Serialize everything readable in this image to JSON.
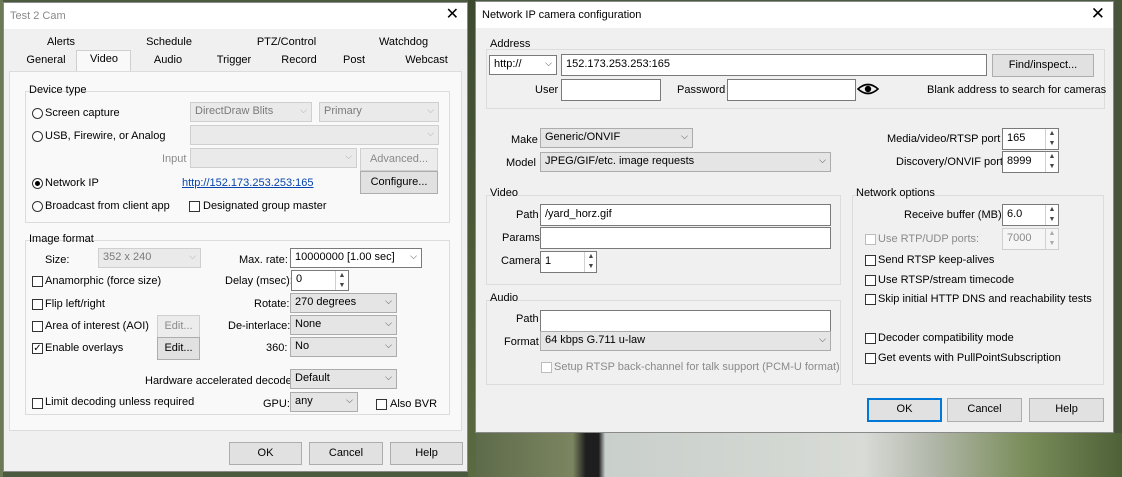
{
  "left": {
    "title": "Test 2 Cam",
    "tabs_row1": [
      "Alerts",
      "Schedule",
      "PTZ/Control",
      "Watchdog"
    ],
    "tabs_row2": [
      "General",
      "Video",
      "Audio",
      "Trigger",
      "Record",
      "Post",
      "Webcast"
    ],
    "device_type": {
      "title": "Device type",
      "screen_capture": "Screen capture",
      "directdraw": "DirectDraw Blits",
      "primary": "Primary",
      "usb": "USB, Firewire, or Analog",
      "input": "Input",
      "advanced": "Advanced...",
      "network_ip": "Network IP",
      "network_link": "http://152.173.253.253:165",
      "configure": "Configure...",
      "broadcast": "Broadcast from client app",
      "designated": "Designated group master"
    },
    "image_format": {
      "title": "Image format",
      "size_label": "Size:",
      "size_value": "352 x 240",
      "max_rate_label": "Max. rate:",
      "max_rate_value": "10000000 [1.00 sec]",
      "anamorphic": "Anamorphic (force size)",
      "delay_label": "Delay (msec):",
      "delay_value": "0",
      "flip": "Flip left/right",
      "rotate_label": "Rotate:",
      "rotate_value": "270 degrees",
      "aoi": "Area of interest (AOI)",
      "edit1": "Edit...",
      "deinterlace_label": "De-interlace:",
      "deinterlace_value": "None",
      "overlays": "Enable overlays",
      "edit2": "Edit...",
      "r360_label": "360:",
      "r360_value": "No",
      "hw_label": "Hardware accelerated decode:",
      "hw_value": "Default",
      "limit": "Limit decoding unless required",
      "gpu_label": "GPU:",
      "gpu_value": "any",
      "also_bvr": "Also BVR"
    },
    "buttons": {
      "ok": "OK",
      "cancel": "Cancel",
      "help": "Help"
    }
  },
  "right": {
    "title": "Network IP camera configuration",
    "address": {
      "title": "Address",
      "scheme": "http://",
      "host": "152.173.253.253:165",
      "find": "Find/inspect...",
      "user_label": "User",
      "user_value": "",
      "password_label": "Password",
      "password_value": "",
      "hint": "Blank address to search for cameras"
    },
    "make_label": "Make",
    "make_value": "Generic/ONVIF",
    "model_label": "Model",
    "model_value": "JPEG/GIF/etc. image requests",
    "media_port_label": "Media/video/RTSP port",
    "media_port_value": "165",
    "discovery_port_label": "Discovery/ONVIF port",
    "discovery_port_value": "8999",
    "video": {
      "title": "Video",
      "path_label": "Path",
      "path_value": "/yard_horz.gif",
      "params_label": "Params",
      "params_value": "",
      "camera_label": "Camera",
      "camera_value": "1"
    },
    "network_options": {
      "title": "Network options",
      "receive_label": "Receive buffer (MB)",
      "receive_value": "6.0",
      "rtp_udp": "Use RTP/UDP ports:",
      "rtp_value": "7000",
      "keepalives": "Send RTSP keep-alives",
      "timecode": "Use RTSP/stream timecode",
      "skip_dns": "Skip initial HTTP DNS and reachability tests",
      "decoder_compat": "Decoder compatibility mode",
      "pullpoint": "Get events with PullPointSubscription"
    },
    "audio": {
      "title": "Audio",
      "path_label": "Path",
      "path_value": "",
      "format_label": "Format",
      "format_value": "64 kbps G.711 u-law",
      "backchannel": "Setup RTSP back-channel for talk support (PCM-U format)"
    },
    "buttons": {
      "ok": "OK",
      "cancel": "Cancel",
      "help": "Help"
    }
  }
}
